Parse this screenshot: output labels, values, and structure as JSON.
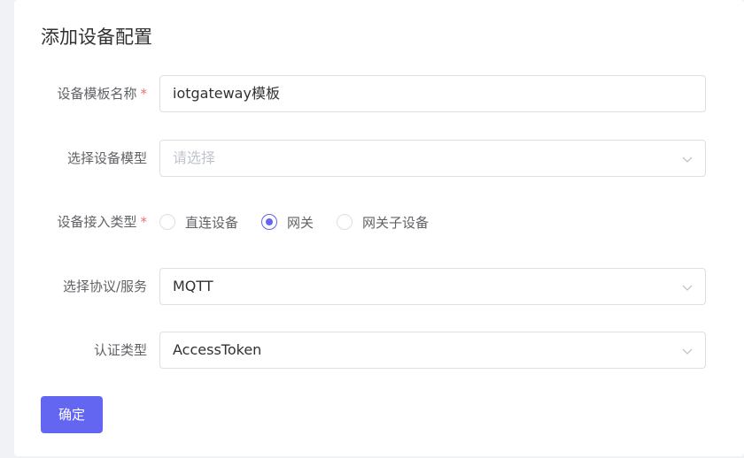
{
  "form": {
    "title": "添加设备配置",
    "template_name": {
      "label": "设备模板名称",
      "required_mark": "*",
      "value": "iotgateway模板"
    },
    "device_model": {
      "label": "选择设备模型",
      "placeholder": "请选择"
    },
    "access_type": {
      "label": "设备接入类型",
      "required_mark": "*",
      "options": [
        "直连设备",
        "网关",
        "网关子设备"
      ],
      "selected": "网关"
    },
    "protocol": {
      "label": "选择协议/服务",
      "value": "MQTT"
    },
    "auth_type": {
      "label": "认证类型",
      "value": "AccessToken"
    },
    "confirm_label": "确定"
  },
  "colors": {
    "primary": "#6366f1",
    "required": "#f56c6c",
    "border": "#dcdfe6",
    "placeholder": "#c0c4cc"
  }
}
